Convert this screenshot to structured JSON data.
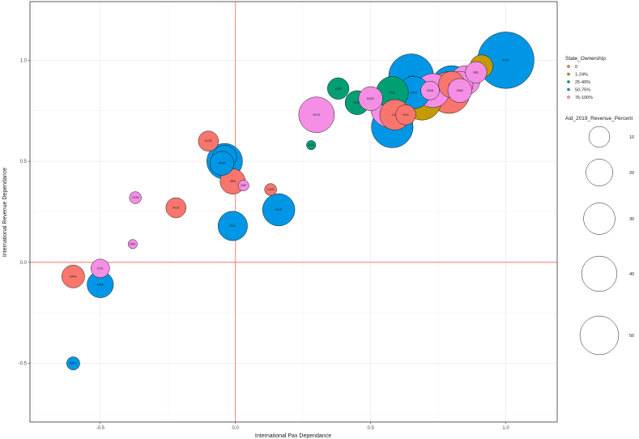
{
  "chart_data": {
    "type": "scatter",
    "title": "",
    "xlabel": "International Pax Dependance",
    "ylabel": "International Revenue Dependance",
    "xlim": [
      -0.76,
      1.19
    ],
    "ylim": [
      -0.79,
      1.29
    ],
    "x_ticks": [
      "-0.5",
      "0.0",
      "0.5",
      "1.0"
    ],
    "y_ticks": [
      "-0.5",
      "0.0",
      "0.5",
      "1.0"
    ],
    "reference_lines": {
      "x": 0,
      "y": 0,
      "color": "#F8766D"
    },
    "grid": true,
    "colors": {
      "0": "#F8766D",
      "1-24%": "#C49A00",
      "25-49%": "#009E73",
      "50-75%": "#0096E6",
      "76-100%": "#F48FE5"
    },
    "legend_color": {
      "title": "State_Ownership",
      "placement": "right",
      "entries": [
        "0",
        "1-24%",
        "25-49%",
        "50-75%",
        "76-100%"
      ]
    },
    "legend_size": {
      "title": "Aid_2019_Revenue_Percent",
      "placement": "right",
      "entries": [
        {
          "label": "10",
          "value": 10
        },
        {
          "label": "20",
          "value": 20
        },
        {
          "label": "30",
          "value": 30
        },
        {
          "label": "40",
          "value": 40
        },
        {
          "label": "50",
          "value": 50
        }
      ]
    },
    "points": [
      {
        "label": "ESP",
        "x": 1.0,
        "y": 1.0,
        "size": 55,
        "group": "50-75%"
      },
      {
        "label": "NLD",
        "x": 0.91,
        "y": 0.97,
        "size": 9,
        "group": "1-24%"
      },
      {
        "label": "BEL",
        "x": 0.89,
        "y": 0.94,
        "size": 8,
        "group": "76-100%"
      },
      {
        "label": "AUT",
        "x": 0.85,
        "y": 0.9,
        "size": 15,
        "group": "76-100%"
      },
      {
        "label": "FIN",
        "x": 0.83,
        "y": 0.88,
        "size": 12,
        "group": "76-100%"
      },
      {
        "label": "DNK",
        "x": 0.83,
        "y": 0.85,
        "size": 10,
        "group": "76-100%"
      },
      {
        "label": "ITA",
        "x": 0.8,
        "y": 0.87,
        "size": 30,
        "group": "50-75%"
      },
      {
        "label": "IRL",
        "x": 0.73,
        "y": 0.85,
        "size": 20,
        "group": "76-100%"
      },
      {
        "label": "DEU",
        "x": 0.79,
        "y": 0.84,
        "size": 30,
        "group": "0"
      },
      {
        "label": "PRT",
        "x": 0.8,
        "y": 0.88,
        "size": 12,
        "group": "0"
      },
      {
        "label": "FRA",
        "x": 0.69,
        "y": 0.8,
        "size": 26,
        "group": "1-24%"
      },
      {
        "label": "TUR",
        "x": 0.65,
        "y": 0.92,
        "size": 35,
        "group": "50-75%"
      },
      {
        "label": "GRC",
        "x": 0.66,
        "y": 0.84,
        "size": 18,
        "group": "50-75%"
      },
      {
        "label": "HUN",
        "x": 0.72,
        "y": 0.85,
        "size": 6,
        "group": "76-100%"
      },
      {
        "label": "POL",
        "x": 0.58,
        "y": 0.84,
        "size": 18,
        "group": "25-49%"
      },
      {
        "label": "LTV",
        "x": 0.57,
        "y": 0.76,
        "size": 24,
        "group": "76-100%"
      },
      {
        "label": "CHL",
        "x": 0.59,
        "y": 0.73,
        "size": 16,
        "group": "0"
      },
      {
        "label": "SVK",
        "x": 0.63,
        "y": 0.73,
        "size": 7,
        "group": "0"
      },
      {
        "label": "ARE",
        "x": 0.58,
        "y": 0.67,
        "size": 30,
        "group": "50-75%"
      },
      {
        "label": "LBN",
        "x": 0.38,
        "y": 0.86,
        "size": 8,
        "group": "25-49%"
      },
      {
        "label": "CRO",
        "x": 0.45,
        "y": 0.79,
        "size": 10,
        "group": "25-49%"
      },
      {
        "label": "BGD",
        "x": 0.5,
        "y": 0.81,
        "size": 10,
        "group": "76-100%"
      },
      {
        "label": "MYS",
        "x": 0.3,
        "y": 0.73,
        "size": 22,
        "group": "76-100%"
      },
      {
        "label": "IND",
        "x": 0.28,
        "y": 0.58,
        "size": 1.5,
        "group": "25-49%"
      },
      {
        "label": "KOR",
        "x": -0.1,
        "y": 0.6,
        "size": 7,
        "group": "0"
      },
      {
        "label": "NZL",
        "x": -0.04,
        "y": 0.5,
        "size": 22,
        "group": "50-75%"
      },
      {
        "label": "NOR",
        "x": -0.04,
        "y": 0.52,
        "size": 10,
        "group": "50-75%"
      },
      {
        "label": "SWE",
        "x": -0.05,
        "y": 0.49,
        "size": 10,
        "group": "50-75%"
      },
      {
        "label": "JPN",
        "x": -0.01,
        "y": 0.4,
        "size": 11,
        "group": "0"
      },
      {
        "label": "ZAF",
        "x": 0.03,
        "y": 0.38,
        "size": 2,
        "group": "76-100%"
      },
      {
        "label": "CAN",
        "x": 0.13,
        "y": 0.36,
        "size": 2.5,
        "group": "0"
      },
      {
        "label": "RUS",
        "x": 0.16,
        "y": 0.26,
        "size": 18,
        "group": "50-75%"
      },
      {
        "label": "CHN",
        "x": -0.37,
        "y": 0.32,
        "size": 2.5,
        "group": "76-100%"
      },
      {
        "label": "AUS",
        "x": -0.22,
        "y": 0.27,
        "size": 7,
        "group": "0"
      },
      {
        "label": "PHL",
        "x": -0.01,
        "y": 0.18,
        "size": 15,
        "group": "50-75%"
      },
      {
        "label": "IDN",
        "x": -0.38,
        "y": 0.09,
        "size": 1.5,
        "group": "76-100%"
      },
      {
        "label": "COL",
        "x": -0.5,
        "y": -0.03,
        "size": 6,
        "group": "76-100%"
      },
      {
        "label": "BRA",
        "x": -0.6,
        "y": -0.07,
        "size": 9,
        "group": "0"
      },
      {
        "label": "USA",
        "x": -0.5,
        "y": -0.11,
        "size": 12,
        "group": "50-75%"
      },
      {
        "label": "MEX",
        "x": -0.6,
        "y": -0.5,
        "size": 3,
        "group": "50-75%"
      }
    ]
  }
}
